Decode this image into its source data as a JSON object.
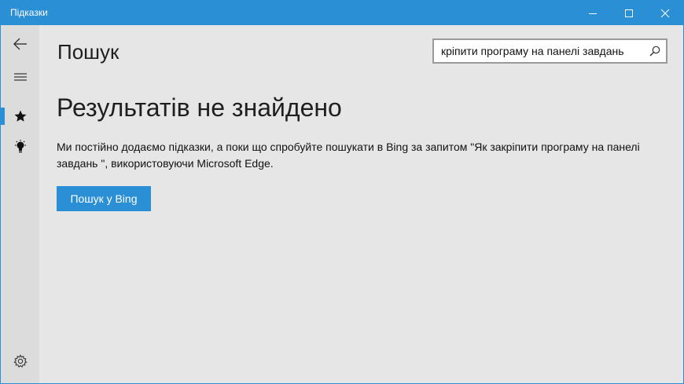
{
  "window": {
    "title": "Підказки",
    "accent_color": "#2b8fd6",
    "controls": [
      "minimize-icon",
      "maximize-icon",
      "close-icon"
    ]
  },
  "sidebar": {
    "items": [
      {
        "icon": "back-arrow-icon"
      },
      {
        "icon": "hamburger-menu-icon"
      },
      {
        "icon": "star-icon",
        "selected": true
      },
      {
        "icon": "lightbulb-icon"
      },
      {
        "icon": "gear-icon"
      }
    ]
  },
  "header": {
    "title": "Пошук"
  },
  "search": {
    "value": "кріпити програму на панелі завдань",
    "icon": "search-icon"
  },
  "main": {
    "headline": "Результатів не знайдено",
    "message": "Ми постійно додаємо підказки, а поки що спробуйте пошукати в Bing за запитом \"Як закріпити програму на панелі завдань \", використовуючи Microsoft Edge.",
    "bing_button_label": "Пошук у Bing"
  }
}
